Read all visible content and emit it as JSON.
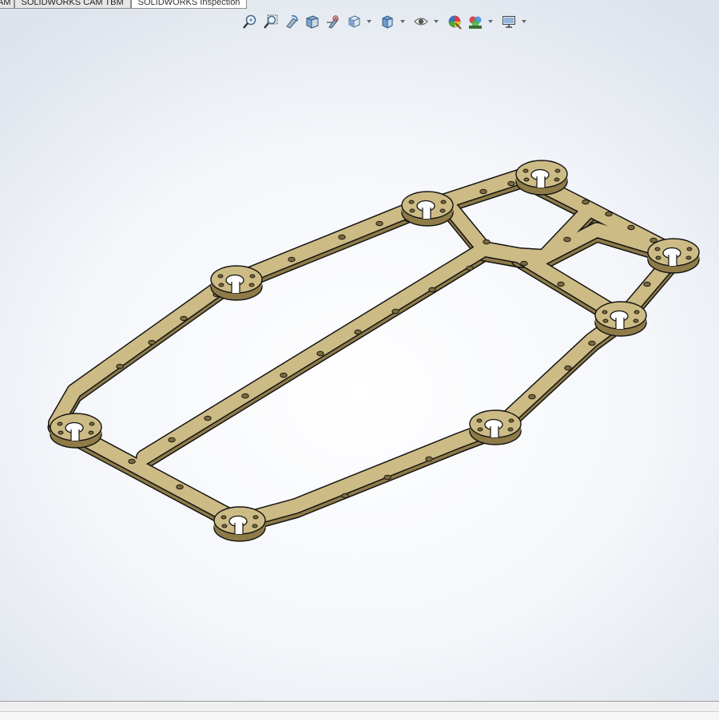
{
  "tabs": [
    {
      "label": "AM"
    },
    {
      "label": "SOLIDWORKS CAM TBM"
    },
    {
      "label": "SOLIDWORKS Inspection"
    }
  ],
  "heads_up_toolbar": [
    {
      "icon": "zoom-to-fit-icon"
    },
    {
      "icon": "zoom-to-area-icon"
    },
    {
      "icon": "previous-view-icon"
    },
    {
      "icon": "section-view-icon"
    },
    {
      "icon": "dynamic-annotation-views-icon"
    },
    {
      "icon": "view-orientation-icon"
    },
    {
      "icon": "display-style-icon"
    },
    {
      "icon": "hide-show-items-icon"
    },
    {
      "icon": "edit-appearance-icon"
    },
    {
      "icon": "apply-scene-icon"
    },
    {
      "icon": "view-settings-icon"
    }
  ],
  "model": {
    "name": "chassis-plate-frame",
    "colors": {
      "top": "#cdbb85",
      "side": "#8e7b48",
      "edge": "#141414",
      "hole": "#7c6a3c"
    }
  }
}
